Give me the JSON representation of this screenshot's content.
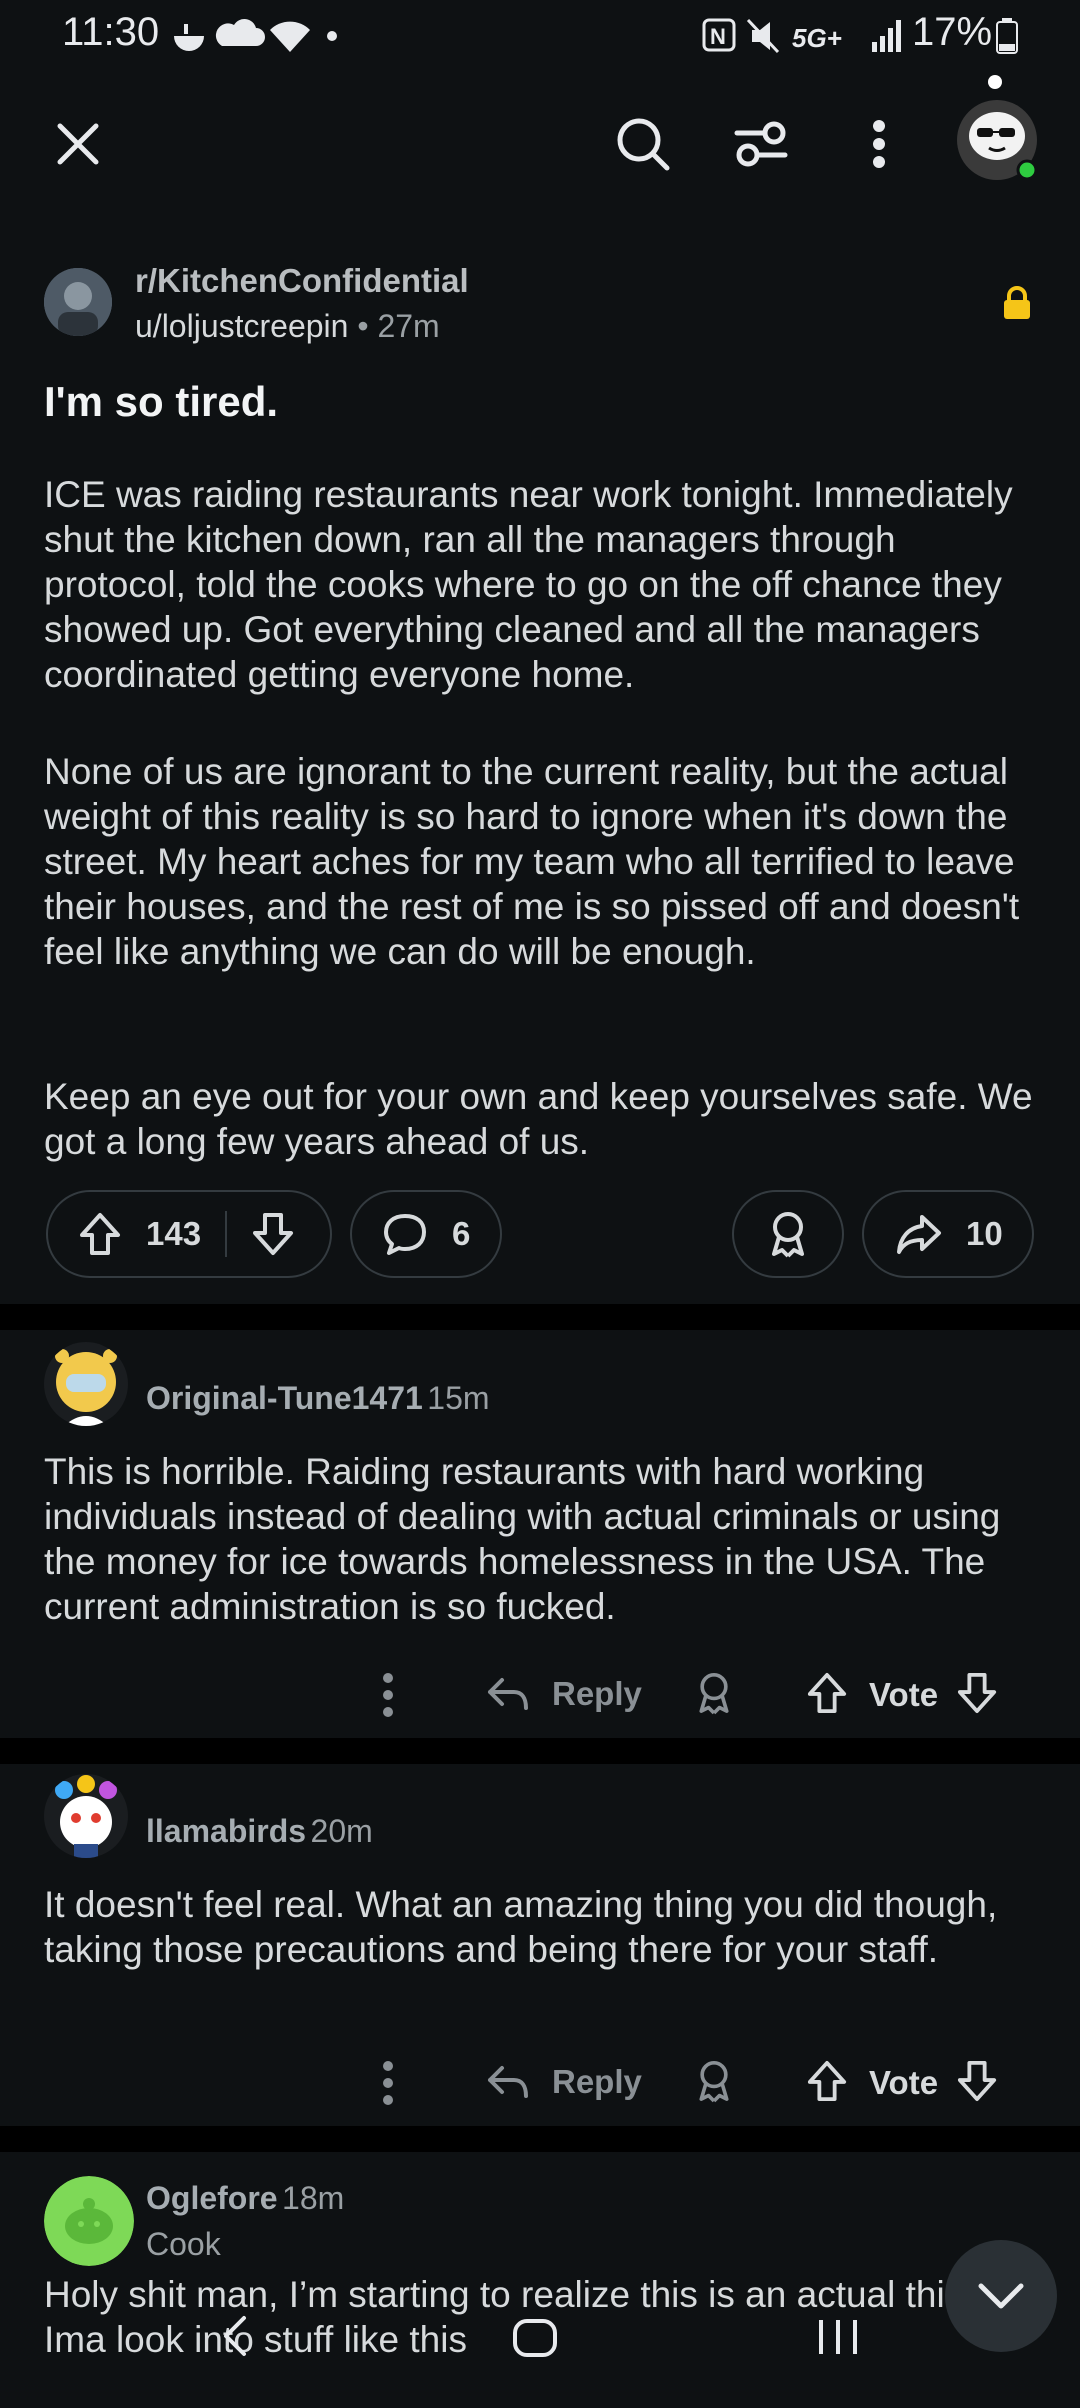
{
  "status_bar": {
    "time": "11:30",
    "network": "5G+",
    "battery": "17%"
  },
  "header": {
    "icons": [
      "close-icon",
      "search-icon",
      "filter-icon",
      "more-vertical-icon",
      "avatar"
    ]
  },
  "post": {
    "subreddit": "r/KitchenConfidential",
    "author": "u/loljustcreepin",
    "age": "27m",
    "title": "I'm so tired.",
    "paragraphs": [
      "ICE was raiding restaurants near work tonight. Immediately shut the kitchen down, ran all the managers through protocol, told the cooks where to go on the off chance they showed up. Got everything cleaned and all the managers coordinated getting everyone home.",
      "None of us are ignorant to the current reality, but the actual weight of this reality is so hard to ignore when it's down the street. My heart aches for my team who all terrified to leave their houses, and the rest of me is so pissed off and doesn't feel like anything we can do will be enough.",
      "Keep an eye out for your own and keep yourselves safe. We got a long few years ahead of us."
    ],
    "upvotes": "143",
    "comments": "6",
    "shares": "10",
    "lock_color": "#f5c518"
  },
  "comments": [
    {
      "user": "Original-Tune1471",
      "age": "15m",
      "text": "This is horrible. Raiding restaurants with hard working individuals instead of dealing with actual criminals or using the money for ice towards homelessness in the USA. The current administration is so fucked.",
      "reply": "Reply",
      "vote": "Vote"
    },
    {
      "user": "llamabirds",
      "age": "20m",
      "text": "It doesn't feel real. What an amazing thing you did though, taking those precautions and being there for your staff.",
      "reply": "Reply",
      "vote": "Vote"
    },
    {
      "user": "Oglefore",
      "age": "18m",
      "flair": "Cook",
      "text": "Holy shit man, I’m starting to realize this is an actual thing. Ima look into stuff like this"
    }
  ],
  "colors": {
    "background": "#0e1113",
    "separator": "#000000",
    "online": "#2ecc40"
  }
}
